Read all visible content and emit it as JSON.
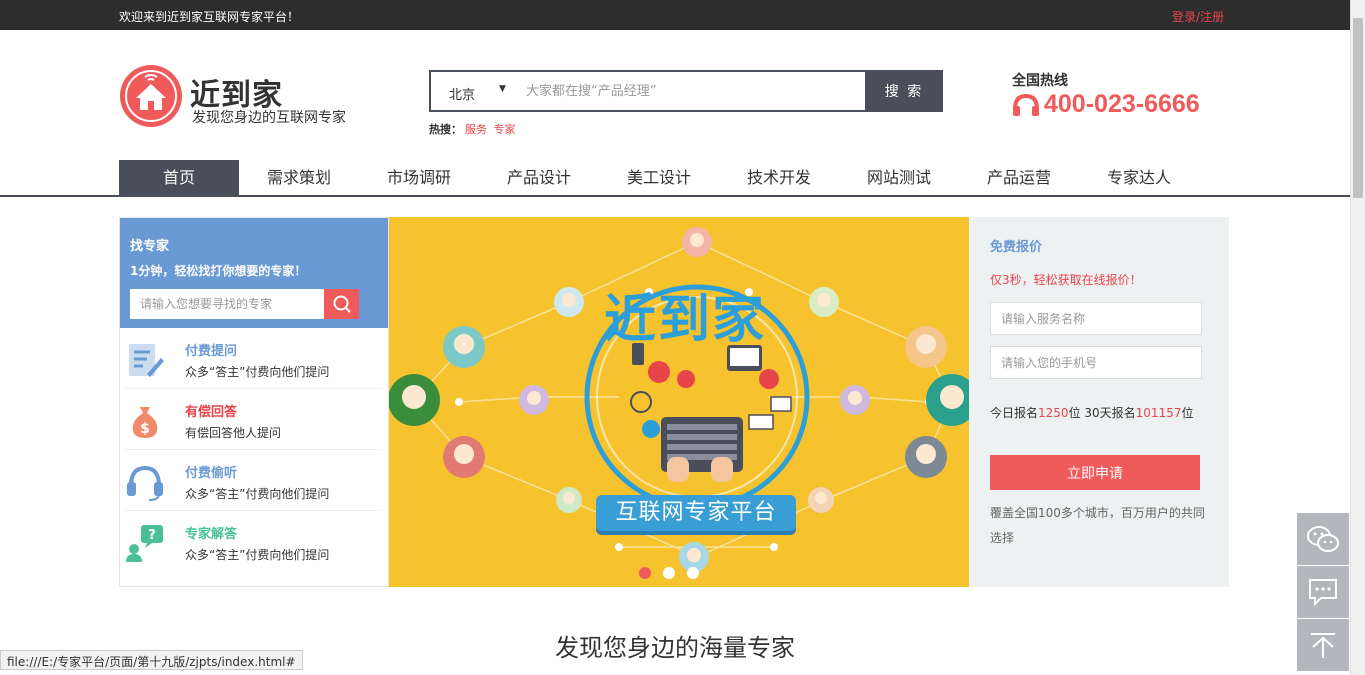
{
  "topbar": {
    "welcome": "欢迎来到近到家互联网专家平台！",
    "login": "登录",
    "sep": "/",
    "register": "注册"
  },
  "logo": {
    "title": "近到家",
    "subtitle": "发现您身边的互联网专家"
  },
  "search": {
    "city": "北京",
    "arrow": "▼",
    "placeholder": "大家都在搜“产品经理”",
    "button": "搜 索"
  },
  "hot": {
    "label": "热搜：",
    "items": [
      "服务",
      "专家"
    ]
  },
  "hotline": {
    "label": "全国热线",
    "number": "400-023-6666"
  },
  "nav": [
    "首页",
    "需求策划",
    "市场调研",
    "产品设计",
    "美工设计",
    "技术开发",
    "网站测试",
    "产品运营",
    "专家达人"
  ],
  "find": {
    "title": "找专家",
    "subtitle": "1分钟，轻松找打你想要的专家！",
    "placeholder": "请输入您想要寻找的专家"
  },
  "services": [
    {
      "title": "付费提问",
      "desc": "众多“答主”付费向他们提问",
      "color": "#6a9ad3",
      "icon": "edit-note-icon"
    },
    {
      "title": "有偿回答",
      "desc": "有偿回答他人提问",
      "color": "#e8454b",
      "icon": "money-bag-icon"
    },
    {
      "title": "付费偷听",
      "desc": "众多“答主”付费向他们提问",
      "color": "#6a9ad3",
      "icon": "headset-icon"
    },
    {
      "title": "专家解答",
      "desc": "众多“答主”付费向他们提问",
      "color": "#4bbf9a",
      "icon": "question-person-icon"
    }
  ],
  "banner": {
    "title": "近到家",
    "tagline": "互联网专家平台"
  },
  "quote": {
    "title": "免费报价",
    "subtitle": "仅3秒，轻松获取在线报价！",
    "service_placeholder": "请输入服务名称",
    "phone_placeholder": "请输入您的手机号",
    "today_label": "今日报名",
    "today_count": "1250",
    "unit1": "位 30天报名",
    "month_count": "101157",
    "unit2": "位",
    "button": "立即申请",
    "note": "覆盖全国100多个城市，百万用户的共同选择"
  },
  "section": {
    "title": "发现您身边的海量专家"
  },
  "status": {
    "url": "file:///E:/专家平台/页面/第十九版/zjpts/index.html#"
  }
}
